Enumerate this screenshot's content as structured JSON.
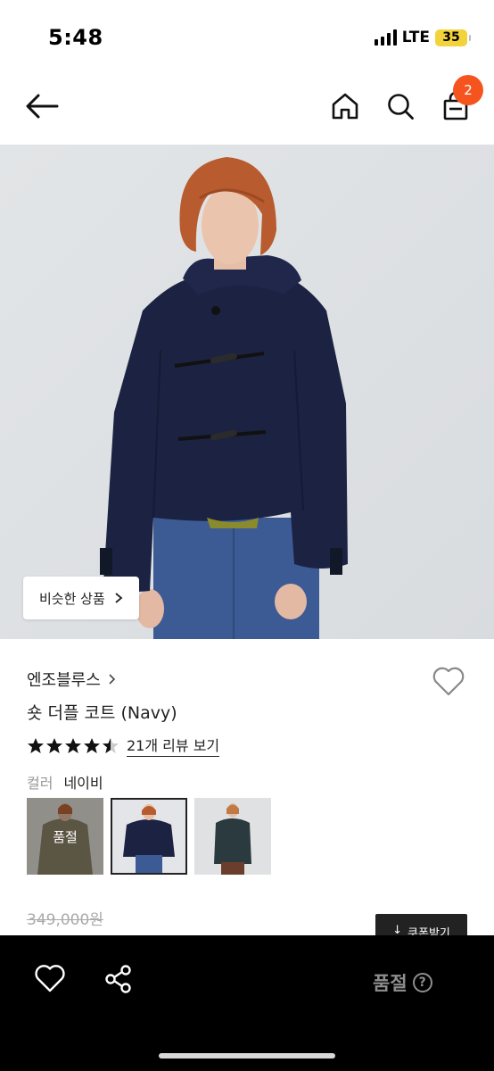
{
  "status_bar": {
    "time": "5:48",
    "network": "LTE",
    "battery": "35"
  },
  "nav": {
    "icons": [
      "back-arrow-icon",
      "home-icon",
      "search-icon",
      "shopping-bag-icon"
    ],
    "cart_count": "2"
  },
  "hero": {
    "similar_button_label": "비슷한 상품"
  },
  "product": {
    "brand": "엔조블루스",
    "name": "숏 더플 코트 (Navy)",
    "rating_stars": 4.5,
    "review_link": "21개 리뷰 보기",
    "color_label": "컬러",
    "color_value": "네이비",
    "swatches": [
      {
        "name": "khaki",
        "tag": "품절",
        "sold_out": true
      },
      {
        "name": "navy",
        "selected": true
      },
      {
        "name": "dark-green"
      }
    ],
    "original_price": "349,000원",
    "coupon_label": "쿠폰받기"
  },
  "bottom_bar": {
    "status_label": "품절",
    "help_glyph": "?"
  },
  "colors": {
    "accent": "#f5541e",
    "battery": "#f3d33c",
    "bottom_bar_bg": "#000000",
    "coat_navy": "#1c2242"
  }
}
